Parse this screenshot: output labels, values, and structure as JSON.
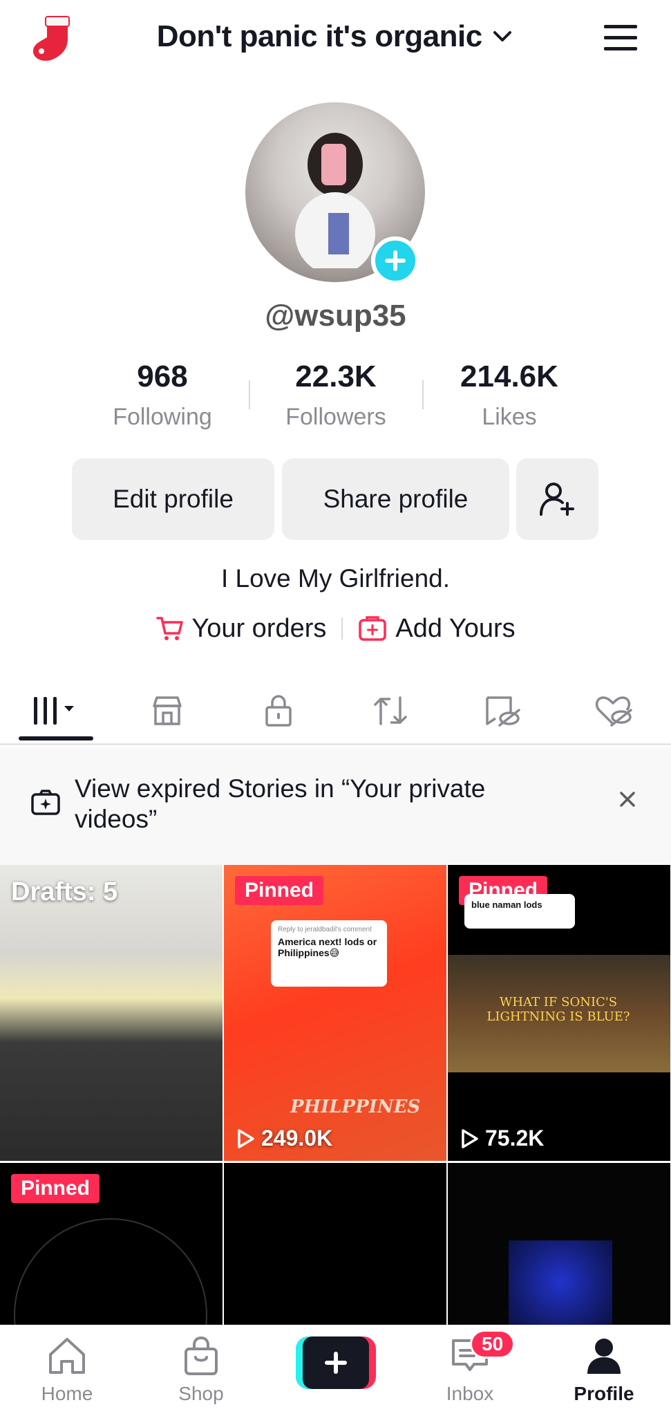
{
  "header": {
    "title": "Don't panic it's organic",
    "icon_logo": "sock-icon",
    "icon_menu": "hamburger-menu-icon"
  },
  "profile": {
    "username": "@wsup35",
    "stats": [
      {
        "value": "968",
        "label": "Following"
      },
      {
        "value": "22.3K",
        "label": "Followers"
      },
      {
        "value": "214.6K",
        "label": "Likes"
      }
    ],
    "edit_label": "Edit profile",
    "share_label": "Share profile",
    "bio": "I Love My Girlfriend.",
    "orders_label": "Your orders",
    "addyours_label": "Add Yours"
  },
  "tabs": [
    {
      "icon": "videos-grid-icon",
      "active": true
    },
    {
      "icon": "shop-icon"
    },
    {
      "icon": "private-lock-icon"
    },
    {
      "icon": "repost-icon"
    },
    {
      "icon": "favorites-icon"
    },
    {
      "icon": "liked-hidden-icon"
    }
  ],
  "notice": {
    "text": "View expired Stories in “Your private videos”"
  },
  "grid": [
    {
      "overlay": "Drafts: 5"
    },
    {
      "pinned": "Pinned",
      "views": "249.0K",
      "bubble_title": "Reply to jeraldbadil's comment",
      "bubble_text": "America next! lods or Philippines😅",
      "caption": "PHILPPINES"
    },
    {
      "pinned": "Pinned",
      "views": "75.2K",
      "bubble_text": "blue naman lods",
      "caption": "WHAT IF SONIC'S LIGHTNING IS BLUE?"
    },
    {
      "pinned": "Pinned"
    },
    {},
    {}
  ],
  "bottom_nav": {
    "home": "Home",
    "shop": "Shop",
    "inbox": "Inbox",
    "inbox_badge": "50",
    "profile": "Profile"
  },
  "colors": {
    "accent_red": "#fe2c55",
    "accent_cyan": "#25f4ee",
    "text": "#161823",
    "muted": "#8a8b91"
  }
}
